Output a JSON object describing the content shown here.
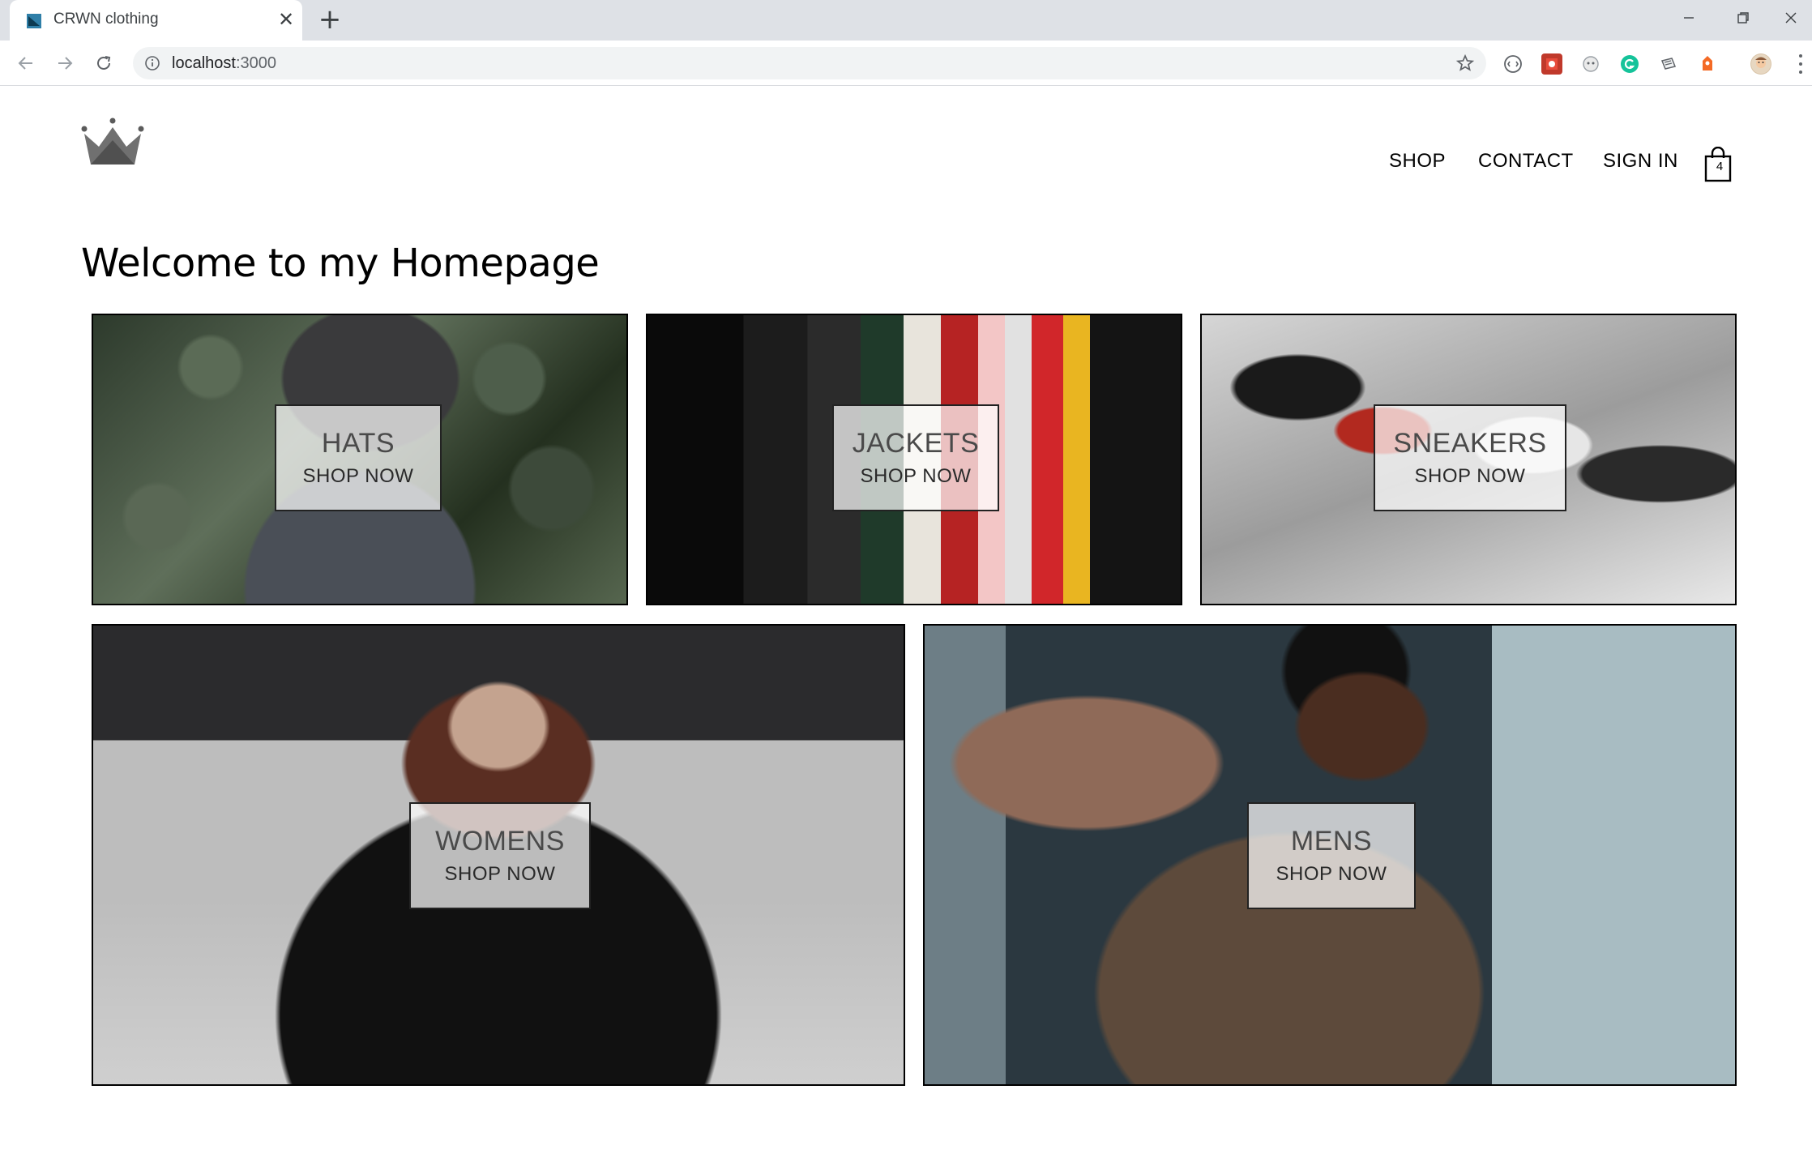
{
  "browser": {
    "tab_title": "CRWN clothing",
    "url_host": "localhost",
    "url_port": ":3000"
  },
  "header": {
    "nav": {
      "shop": "SHOP",
      "contact": "CONTACT",
      "sign_in": "SIGN IN"
    },
    "cart_count": "4"
  },
  "main": {
    "title": "Welcome to my Homepage",
    "cta": "SHOP NOW",
    "categories": [
      {
        "title": "HATS"
      },
      {
        "title": "JACKETS"
      },
      {
        "title": "SNEAKERS"
      },
      {
        "title": "WOMENS"
      },
      {
        "title": "MENS"
      }
    ]
  }
}
